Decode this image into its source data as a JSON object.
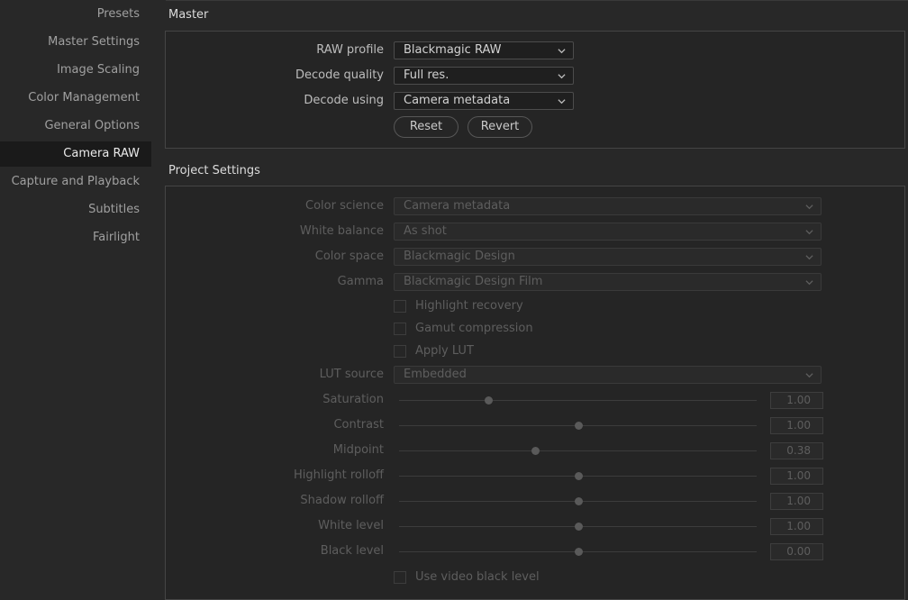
{
  "sidebar": {
    "items": [
      {
        "label": "Presets"
      },
      {
        "label": "Master Settings"
      },
      {
        "label": "Image Scaling"
      },
      {
        "label": "Color Management"
      },
      {
        "label": "General Options"
      },
      {
        "label": "Camera RAW",
        "active": true
      },
      {
        "label": "Capture and Playback"
      },
      {
        "label": "Subtitles"
      },
      {
        "label": "Fairlight"
      }
    ]
  },
  "master": {
    "title": "Master",
    "raw_profile": {
      "label": "RAW profile",
      "value": "Blackmagic RAW"
    },
    "decode_quality": {
      "label": "Decode quality",
      "value": "Full res."
    },
    "decode_using": {
      "label": "Decode using",
      "value": "Camera metadata"
    },
    "reset_label": "Reset",
    "revert_label": "Revert"
  },
  "project": {
    "title": "Project Settings",
    "color_science": {
      "label": "Color science",
      "value": "Camera metadata"
    },
    "white_balance": {
      "label": "White balance",
      "value": "As shot"
    },
    "color_space": {
      "label": "Color space",
      "value": "Blackmagic Design"
    },
    "gamma": {
      "label": "Gamma",
      "value": "Blackmagic Design Film"
    },
    "highlight_recovery": "Highlight recovery",
    "gamut_compression": "Gamut compression",
    "apply_lut": "Apply LUT",
    "lut_source": {
      "label": "LUT source",
      "value": "Embedded"
    },
    "saturation": {
      "label": "Saturation",
      "value": "1.00",
      "slider_fraction": 0.25
    },
    "contrast": {
      "label": "Contrast",
      "value": "1.00",
      "slider_fraction": 0.5
    },
    "midpoint": {
      "label": "Midpoint",
      "value": "0.38",
      "slider_fraction": 0.38
    },
    "highlight_rolloff": {
      "label": "Highlight rolloff",
      "value": "1.00",
      "slider_fraction": 0.5
    },
    "shadow_rolloff": {
      "label": "Shadow rolloff",
      "value": "1.00",
      "slider_fraction": 0.5
    },
    "white_level": {
      "label": "White level",
      "value": "1.00",
      "slider_fraction": 0.5
    },
    "black_level": {
      "label": "Black level",
      "value": "0.00",
      "slider_fraction": 0.5
    },
    "use_video_black_level": "Use video black level"
  },
  "colors": {
    "background": "#282828",
    "sidebar_active": "#1a1a1a",
    "panel_border": "#454545",
    "text": "#c8c8c8",
    "text_dim": "#5e5e5e"
  }
}
